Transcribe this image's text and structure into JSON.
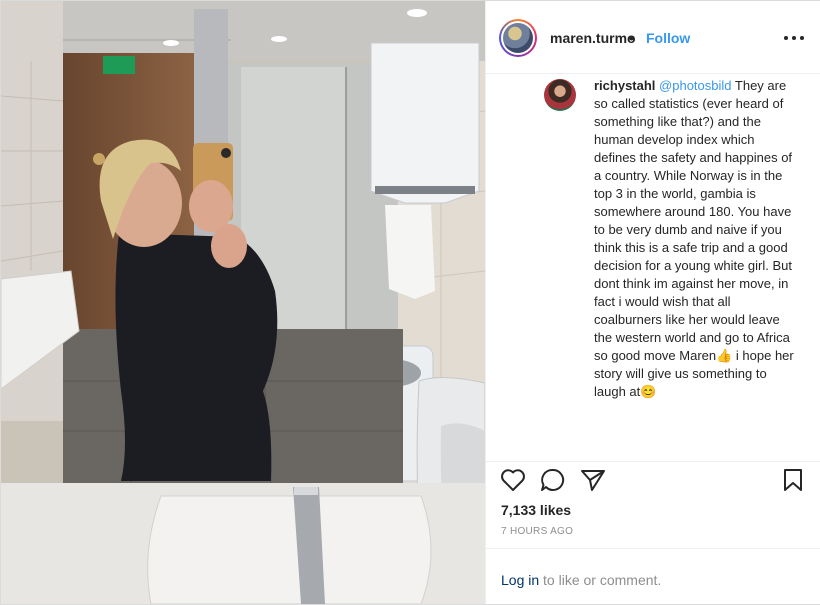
{
  "post": {
    "username": "maren.turmo",
    "separator": "•",
    "follow_label": "Follow",
    "more_icon": "more-options-icon"
  },
  "comment": {
    "username": "richystahl",
    "mention": "@photosbild",
    "text_part1": " They are so called statistics (ever heard of something like that?) and the human develop index which defines the safety and happines of a country. While Norway is in the top 3 in the world, gambia is somewhere around 180. You have to be very dumb and naive if you think this is a safe trip and a good decision for a young white girl. But dont think im against her move, in fact i would wish that all coalburners like her would leave the western world and go to Africa so good move Maren",
    "emoji1": "👍",
    "text_part2": " i hope her story will give us something to laugh at",
    "emoji2": "😊"
  },
  "actions": {
    "like_icon": "heart-icon",
    "comment_icon": "comment-icon",
    "share_icon": "share-icon",
    "save_icon": "bookmark-icon"
  },
  "likes_count": "7,133",
  "likes_suffix": " likes",
  "time_ago": "7 HOURS AGO",
  "login": {
    "link_label": "Log in",
    "rest_label": " to like or comment."
  },
  "colors": {
    "link_blue": "#3897f0",
    "muted": "#8e8e8e",
    "text": "#262626"
  }
}
